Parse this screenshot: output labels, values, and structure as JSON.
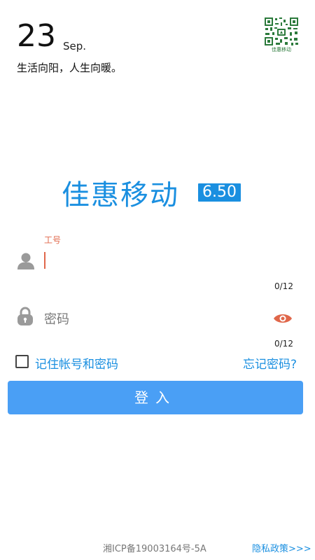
{
  "header": {
    "day": "23",
    "month": "Sep.",
    "motto": "生活向阳，人生向暖。",
    "qr_caption": "佳惠移动"
  },
  "app": {
    "name": "佳惠移动",
    "version": "6.50"
  },
  "form": {
    "username": {
      "label": "工号",
      "value": "",
      "counter": "0/12"
    },
    "password": {
      "placeholder": "密码",
      "value": "",
      "counter": "0/12"
    },
    "remember_label": "记住帐号和密码",
    "remember_checked": false,
    "forgot_label": "忘记密码?",
    "login_label": "登入"
  },
  "footer": {
    "icp": "湘ICP备19003164号-5A",
    "privacy": "隐私政策>>>"
  },
  "colors": {
    "accent": "#1a8fe0",
    "button": "#4a9ff5",
    "focus": "#e0674a",
    "qr": "#2b7a3b"
  }
}
